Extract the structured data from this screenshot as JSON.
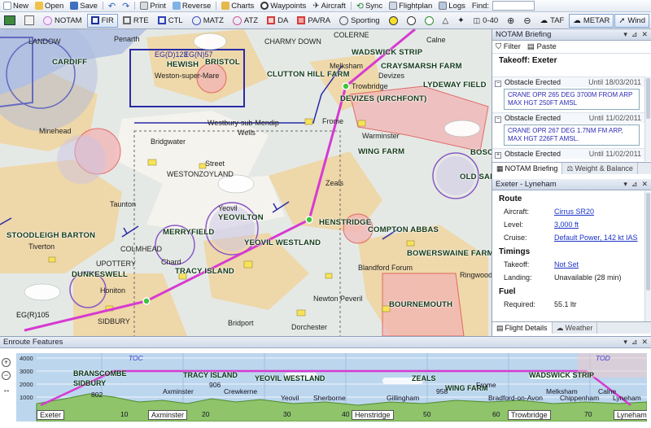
{
  "toolbar": {
    "new": "New",
    "open": "Open",
    "save": "Save",
    "print": "Print",
    "reverse": "Reverse",
    "charts": "Charts",
    "waypoints": "Waypoints",
    "aircraft": "Aircraft",
    "sync": "Sync",
    "flightplan": "Flightplan",
    "logs": "Logs",
    "find_label": "Find:",
    "find_value": ""
  },
  "filters": {
    "notam": "NOTAM",
    "fir": "FIR",
    "rte": "RTE",
    "ctl": "CTL",
    "matz": "MATZ",
    "atz": "ATZ",
    "da": "DA",
    "pa_ra": "PA/RA",
    "sporting": "Sporting",
    "range": "0-40",
    "taf": "TAF",
    "metar": "METAR",
    "wind": "Wind"
  },
  "map_labels": {
    "places": [
      "Penarth",
      "Weston-super-Mare",
      "Westbury-sub-Mendip",
      "Wells",
      "Frome",
      "Bridgwater",
      "Street",
      "Warminster",
      "Zeals",
      "Trowbridge",
      "Melksham",
      "Devizes",
      "Taunton",
      "Tiverton",
      "Honiton",
      "Chard",
      "Bridport",
      "Dorchester",
      "Blandford Forum",
      "Ringwood",
      "Newton Peveril",
      "Yeovil",
      "Minehead",
      "Calne"
    ],
    "airfields": [
      "CARDIFF",
      "BRISTOL",
      "HEWISH",
      "CLUTTON HILL FARM",
      "WADSWICK STRIP",
      "CRAYSMARSH FARM",
      "LYDEWAY FIELD",
      "DEVIZES (URCHFONT)",
      "WING FARM",
      "HENSTRIDGE",
      "YEOVIL WESTLAND",
      "YEOVILTON",
      "MERRYFIELD",
      "TRACY ISLAND",
      "DUNKESWELL",
      "STOODLEIGH BARTON",
      "COMPTON ABBAS",
      "BOWERSWAINE FARM",
      "BOURNEMOUTH",
      "OLD SARUM",
      "BOSCOMBE",
      "WESTONZOYLAND",
      "UPOTTERY",
      "COLMHEAD",
      "SIDBURY",
      "CHARMY DOWN",
      "COLERNE",
      "LANDOW"
    ],
    "region_tags": [
      "EG(D)123",
      "EG(N)57",
      "EG(R)105"
    ]
  },
  "notam_panel": {
    "title": "NOTAM Briefing",
    "filter_label": "Filter",
    "paste_label": "Paste",
    "section": "Takeoff: Exeter",
    "items": [
      {
        "type": "Obstacle Erected",
        "until": "Until 18/03/2011",
        "detail": "CRANE OPR 265 DEG 3700M FROM ARP MAX HGT 250FT AMSL"
      },
      {
        "type": "Obstacle Erected",
        "until": "Until 11/02/2011",
        "detail": "CRANE OPR 267 DEG 1.7NM FM ARP, MAX HGT 226FT AMSL."
      },
      {
        "type": "Obstacle Erected",
        "until": "Until 11/02/2011",
        "detail": ""
      }
    ],
    "tabs": [
      "NOTAM Briefing",
      "Weight & Balance"
    ]
  },
  "route_panel": {
    "title": "Exeter - Lyneham",
    "route_header": "Route",
    "aircraft_label": "Aircraft:",
    "aircraft_value": "Cirrus SR20",
    "level_label": "Level:",
    "level_value": "3,000 ft",
    "cruise_label": "Cruise:",
    "cruise_value": "Default Power, 142 kt IAS",
    "timings_header": "Timings",
    "takeoff_label": "Takeoff:",
    "takeoff_value": "Not Set",
    "landing_label": "Landing:",
    "landing_value": "Unavailable (28 min)",
    "fuel_header": "Fuel",
    "required_label": "Required:",
    "required_value": "55.1 ltr",
    "tabs": [
      "Flight Details",
      "Weather"
    ]
  },
  "enroute": {
    "title": "Enroute Features",
    "alt_ticks": [
      "4000",
      "3000",
      "2000",
      "1000"
    ],
    "waypoints": [
      "Exeter",
      "Axminster",
      "Henstridge",
      "Trowbridge",
      "Lyneham"
    ],
    "distance_ticks": [
      "10",
      "20",
      "30",
      "40",
      "50",
      "60",
      "70"
    ],
    "toc_label": "TOC",
    "tod_label": "TOD",
    "features": [
      "BRANSCOMBE",
      "SIDBURY",
      "TRACY ISLAND",
      "YEOVIL WESTLAND",
      "ZEALS",
      "WING FARM",
      "WADSWICK STRIP"
    ],
    "places": [
      "Axminster",
      "Crewkerne",
      "Yeovil",
      "Sherborne",
      "Gillingham",
      "Frome",
      "Melksham",
      "Bradford-on-Avon",
      "Chippenham",
      "Calne",
      "Lyneham"
    ],
    "spot_heights": [
      "802",
      "906",
      "958"
    ]
  },
  "colors": {
    "route": "#d63ad0",
    "terrain": "#f0d9a8",
    "controlled": "#2a2aa8",
    "danger": "#e04a4a"
  }
}
